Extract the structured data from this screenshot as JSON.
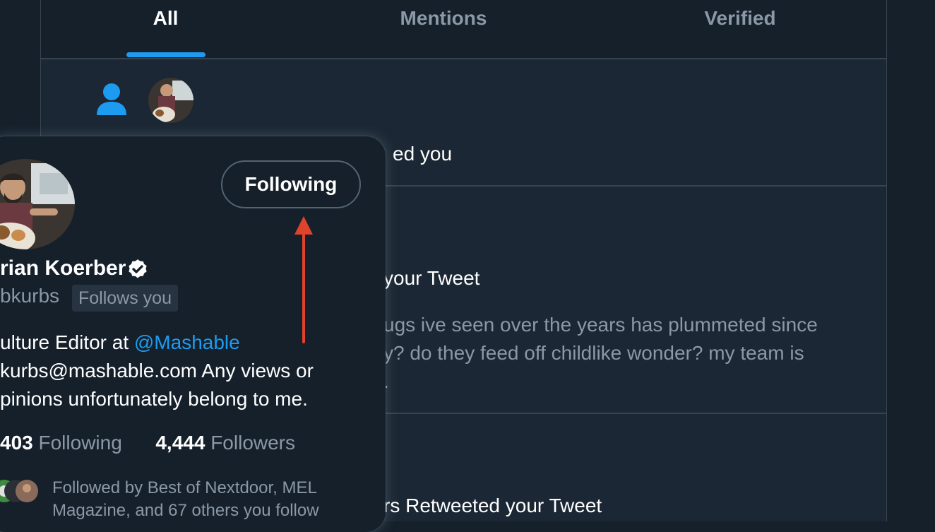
{
  "tabs": [
    {
      "label": "All",
      "active": true
    },
    {
      "label": "Mentions",
      "active": false
    },
    {
      "label": "Verified",
      "active": false
    }
  ],
  "notifications": [
    {
      "text": "ed you",
      "icon": "person-icon"
    },
    {
      "title": "your Tweet",
      "body_lines": [
        "ugs ive seen over the years has plummeted since",
        "y? do they feed off childlike wonder? my team is",
        "."
      ]
    },
    {
      "text": "rs Retweeted your Tweet"
    }
  ],
  "hovercard": {
    "follow_button_label": "Following",
    "name": "rian Koerber",
    "handle": "bkurbs",
    "follows_you_badge": "Follows you",
    "bio_line1_prefix": "ulture Editor at ",
    "bio_mention": "@Mashable",
    "bio_line2": "kurbs@mashable.com Any views or",
    "bio_line3": "pinions unfortunately belong to me.",
    "following_count": "403",
    "following_label": "Following",
    "followers_count": "4,444",
    "followers_label": "Followers",
    "followed_by_line1": "Followed by Best of Nextdoor, MEL",
    "followed_by_line2": "Magazine, and 67 others you follow"
  },
  "colors": {
    "accent": "#1d9bf0",
    "annotation_arrow": "#e0432b",
    "background": "#15202b",
    "secondary_text": "#8b98a5"
  }
}
